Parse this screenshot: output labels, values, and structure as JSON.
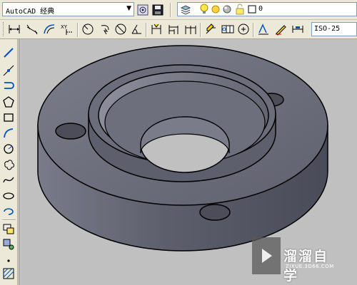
{
  "toolbar": {
    "workspace_value": "AutoCAD 经典",
    "workspace_arrow": "▼",
    "layer_value": "0",
    "dim_style_value": "ISO-25"
  },
  "watermark": {
    "title": "溜溜自学",
    "url": "ZIXUE.3D66.COM"
  },
  "colors": {
    "canvas_bg": "#c0c0c0",
    "model_face": "#6a6b7a",
    "ui_bg": "#ece9d8"
  }
}
